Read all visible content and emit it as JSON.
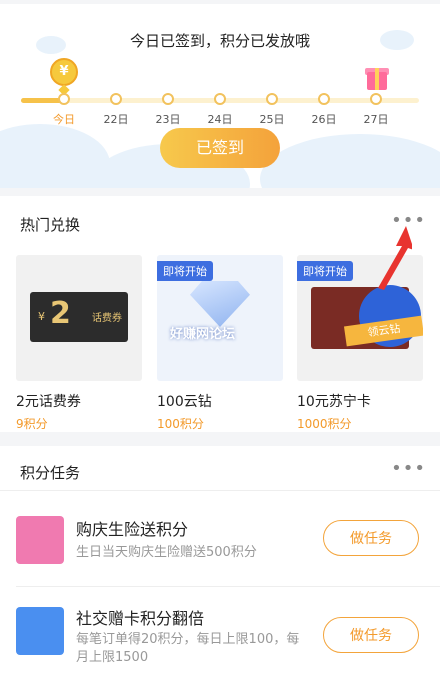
{
  "checkin": {
    "title": "今日已签到，积分已发放哦",
    "coin_symbol": "¥",
    "days": [
      "今日",
      "22日",
      "23日",
      "24日",
      "25日",
      "26日",
      "27日"
    ],
    "button": "已签到"
  },
  "hot": {
    "title": "热门兑换",
    "more": "•••",
    "items": [
      {
        "name": "2元话费券",
        "points": "9积分",
        "badge": "",
        "image": {
          "yen": "¥",
          "amount": "2",
          "tag": "话费券"
        }
      },
      {
        "name": "100云钻",
        "points": "100积分",
        "badge": "即将开始"
      },
      {
        "name": "10元苏宁卡",
        "points": "1000积分",
        "badge": "即将开始",
        "image": {
          "ribbon": "领云钻"
        }
      }
    ],
    "watermark": "好赚网论坛"
  },
  "tasks": {
    "title": "积分任务",
    "more": "•••",
    "items": [
      {
        "title": "购庆生险送积分",
        "desc": "生日当天购庆生险赠送500积分",
        "button": "做任务",
        "icon_color": "#f07ab0"
      },
      {
        "title": "社交赠卡积分翻倍",
        "desc": "每笔订单得20积分，每日上限100，每月上限1500",
        "button": "做任务",
        "icon_color": "#4a8ff0"
      }
    ]
  },
  "colors": {
    "accent": "#f39a2b",
    "badge": "#3d6ee0",
    "arrow": "#e8342f"
  }
}
